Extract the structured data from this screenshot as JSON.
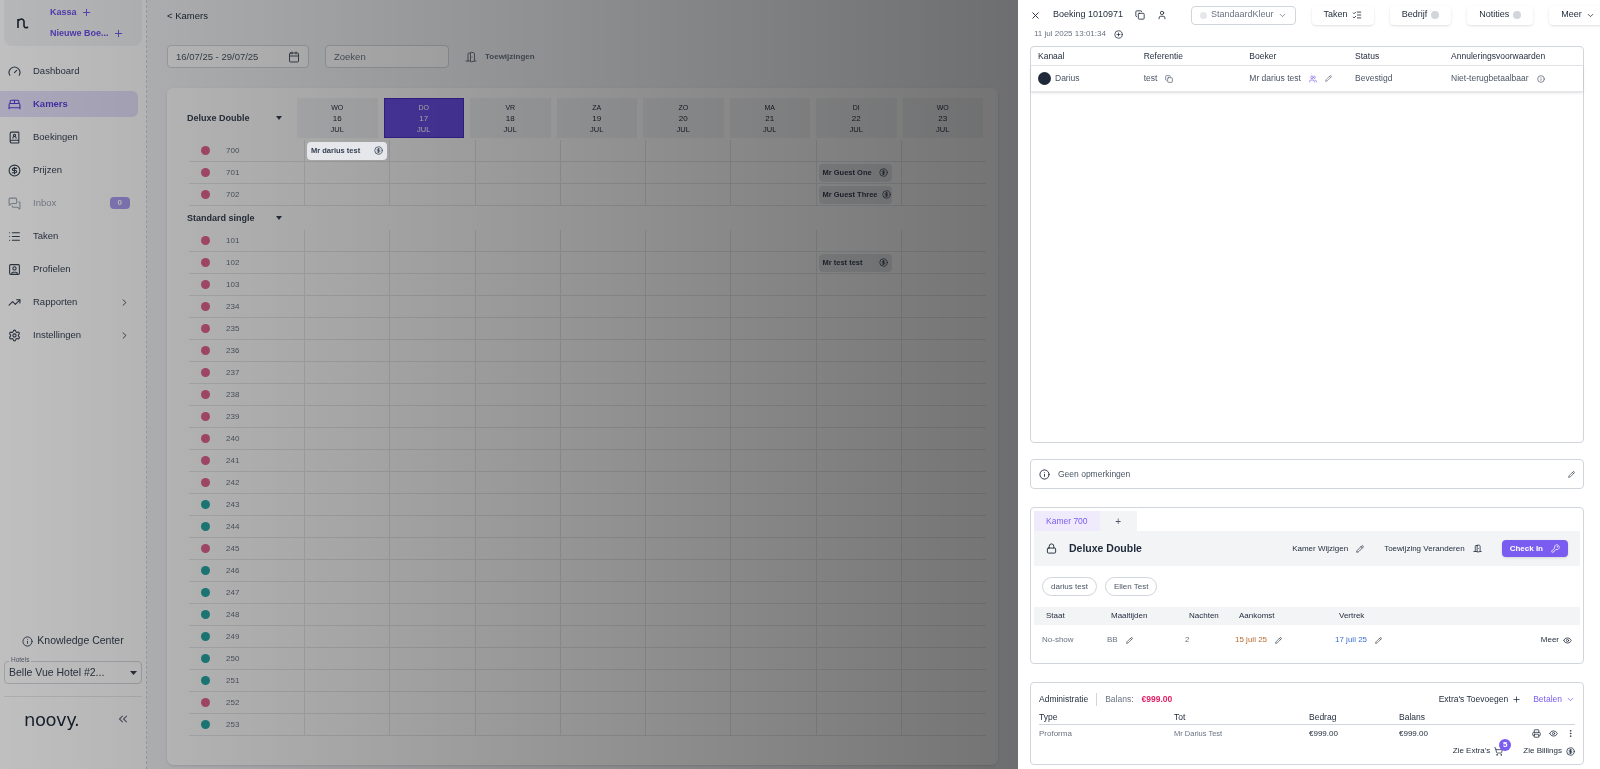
{
  "sidebar": {
    "quick_actions": [
      {
        "label": "Kassa"
      },
      {
        "label": "Nieuwe Boe..."
      }
    ],
    "nav": [
      {
        "label": "Dashboard",
        "selected": false,
        "disabled": false,
        "has_submenu": false
      },
      {
        "label": "Kamers",
        "selected": true,
        "disabled": false,
        "has_submenu": false
      },
      {
        "label": "Boekingen",
        "selected": false,
        "disabled": false,
        "has_submenu": false
      },
      {
        "label": "Prijzen",
        "selected": false,
        "disabled": false,
        "has_submenu": false
      },
      {
        "label": "Inbox",
        "selected": false,
        "disabled": true,
        "has_submenu": false,
        "badge": "0"
      },
      {
        "label": "Taken",
        "selected": false,
        "disabled": false,
        "has_submenu": false
      },
      {
        "label": "Profielen",
        "selected": false,
        "disabled": false,
        "has_submenu": false
      },
      {
        "label": "Rapporten",
        "selected": false,
        "disabled": false,
        "has_submenu": true
      },
      {
        "label": "Instellingen",
        "selected": false,
        "disabled": false,
        "has_submenu": true
      }
    ],
    "knowledge_center": "Knowledge Center",
    "hotel_select": {
      "label": "Hotels",
      "value": "Belle Vue Hotel #2..."
    },
    "logo": "noovy."
  },
  "main": {
    "breadcrumb": "< Kamers",
    "date_range": "16/07/25 - 29/07/25",
    "search": {
      "placeholder": "Zoeken"
    },
    "assignments_button": {
      "label": "Toewijzingen",
      "disabled": true
    },
    "calendar": {
      "days": [
        {
          "weekday": "WO",
          "date": "16",
          "month": "JUL",
          "selected": false
        },
        {
          "weekday": "DO",
          "date": "17",
          "month": "JUL",
          "selected": true
        },
        {
          "weekday": "VR",
          "date": "18",
          "month": "JUL",
          "selected": false
        },
        {
          "weekday": "ZA",
          "date": "19",
          "month": "JUL",
          "selected": false
        },
        {
          "weekday": "ZO",
          "date": "20",
          "month": "JUL",
          "selected": false
        },
        {
          "weekday": "MA",
          "date": "21",
          "month": "JUL",
          "selected": false
        },
        {
          "weekday": "DI",
          "date": "22",
          "month": "JUL",
          "selected": false
        },
        {
          "weekday": "WO",
          "date": "23",
          "month": "JUL",
          "selected": false
        }
      ],
      "groups": [
        {
          "name": "Deluxe Double",
          "expanded": true,
          "rooms": [
            {
              "number": "700",
              "color": "#9c4564",
              "cells": [
                {
                  "guest": "Mr darius test"
                },
                null,
                null,
                null,
                null,
                null,
                null,
                null
              ]
            },
            {
              "number": "701",
              "color": "#9c4564",
              "cells": [
                null,
                null,
                null,
                null,
                null,
                null,
                {
                  "guest": "Mr Guest One"
                },
                null
              ]
            },
            {
              "number": "702",
              "color": "#9c4564",
              "cells": [
                null,
                null,
                null,
                null,
                null,
                null,
                {
                  "guest": "Mr Guest Three"
                },
                null
              ]
            }
          ]
        },
        {
          "name": "Standard single",
          "expanded": true,
          "rooms": [
            {
              "number": "101",
              "color": "#9c4564"
            },
            {
              "number": "102",
              "color": "#9c4564",
              "cells": [
                null,
                null,
                null,
                null,
                null,
                null,
                {
                  "guest": "Mr test test"
                },
                null
              ]
            },
            {
              "number": "103",
              "color": "#9c4564"
            },
            {
              "number": "234",
              "color": "#9c4564"
            },
            {
              "number": "235",
              "color": "#9c4564"
            },
            {
              "number": "236",
              "color": "#9c4564"
            },
            {
              "number": "237",
              "color": "#9c4564"
            },
            {
              "number": "238",
              "color": "#9c4564"
            },
            {
              "number": "239",
              "color": "#9c4564"
            },
            {
              "number": "240",
              "color": "#9c4564"
            },
            {
              "number": "241",
              "color": "#9c4564"
            },
            {
              "number": "242",
              "color": "#9c4564"
            },
            {
              "number": "243",
              "color": "#1b7471"
            },
            {
              "number": "244",
              "color": "#1b7471"
            },
            {
              "number": "245",
              "color": "#9c4564"
            },
            {
              "number": "246",
              "color": "#1b7471"
            },
            {
              "number": "247",
              "color": "#1b7471"
            },
            {
              "number": "248",
              "color": "#1b7471"
            },
            {
              "number": "249",
              "color": "#1b7471"
            },
            {
              "number": "250",
              "color": "#1b7471"
            },
            {
              "number": "251",
              "color": "#1b7471"
            },
            {
              "number": "252",
              "color": "#9c4564"
            },
            {
              "number": "253",
              "color": "#1b7471"
            }
          ]
        }
      ]
    }
  },
  "booking_panel": {
    "title": "Boeking 1010971",
    "color_select": "StandaardKleur",
    "header_buttons": [
      {
        "label": "Taken",
        "kind": "icon"
      },
      {
        "label": "Bedrijf",
        "kind": "badge"
      },
      {
        "label": "Notities",
        "kind": "badge"
      },
      {
        "label": "Meer",
        "kind": "caret"
      }
    ],
    "created": "11 jul 2025 13:01:34",
    "details": {
      "columns": [
        "Kanaal",
        "Referentie",
        "Boeker",
        "Status",
        "Annuleringsvoorwaarden"
      ],
      "row": {
        "channel": "Darius",
        "reference": "test",
        "booker": "Mr darius test",
        "status": "Bevestigd",
        "cancellation": "Niet-terugbetaalbaar"
      }
    },
    "remarks": "Geen opmerkingen",
    "rooms": {
      "tabs": [
        {
          "label": "Kamer 700",
          "selected": true
        }
      ],
      "add_tab": "+",
      "room_type": "Deluxe Double",
      "actions": [
        "Kamer Wijzigen",
        "Toewijzing Veranderen"
      ],
      "check_in": "Check In",
      "guests": [
        "darius test",
        "Ellen Test"
      ],
      "stay_columns": [
        "Staat",
        "Maaltijden",
        "Nachten",
        "Aankomst",
        "Vertrek"
      ],
      "stay": {
        "state": "No-show",
        "meals": "BB",
        "nights": "2",
        "arrival": "15 juli 25",
        "departure": "17 juli 25",
        "more": "Meer"
      }
    },
    "administration": {
      "title": "Administratie",
      "balance_label": "Balans:",
      "balance": "€999.00",
      "add_extras": "Extra's Toevoegen",
      "pay": "Betalen",
      "columns": [
        "Type",
        "Tot",
        "Bedrag",
        "Balans"
      ],
      "rows": [
        {
          "type": "Proforma",
          "to": "Mr Darius Test",
          "amount": "€999.00",
          "balance": "€999.00"
        }
      ],
      "see_extras": "Zie Extra's",
      "extras_count": "5",
      "see_billings": "Zie Billings"
    }
  }
}
